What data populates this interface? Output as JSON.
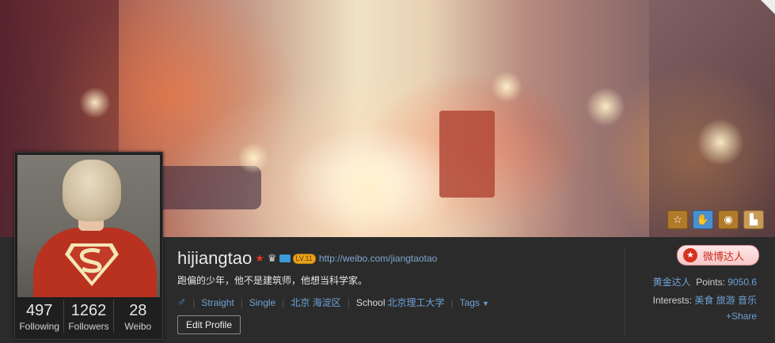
{
  "badges": [
    {
      "icon": "star-badge-icon",
      "glyph": "☆"
    },
    {
      "icon": "hand-badge-icon",
      "glyph": "✋"
    },
    {
      "icon": "location-badge-icon",
      "glyph": "◉"
    },
    {
      "icon": "map-badge-icon",
      "glyph": "▙"
    }
  ],
  "profile": {
    "username": "hijiangtao",
    "homepage": "http://weibo.com/jiangtaotao",
    "bio": "跑偏的少年，他不是建筑师，他想当科学家。",
    "gender_symbol": "♂",
    "orientation": "Straight",
    "relationship": "Single",
    "location": "北京 海淀区",
    "school_label": "School",
    "school": "北京理工大学",
    "tags_label": "Tags",
    "edit_label": "Edit Profile",
    "level_badge": "LV.11"
  },
  "stats": [
    {
      "num": "497",
      "label": "Following"
    },
    {
      "num": "1262",
      "label": "Followers"
    },
    {
      "num": "28",
      "label": "Weibo"
    }
  ],
  "right": {
    "talent_button": "微博达人",
    "talent_title": "黄金达人",
    "points_label": "Points:",
    "points_value": "9050.6",
    "interests_label": "Interests:",
    "interests": "美食 旅游 音乐",
    "share": "+Share"
  }
}
